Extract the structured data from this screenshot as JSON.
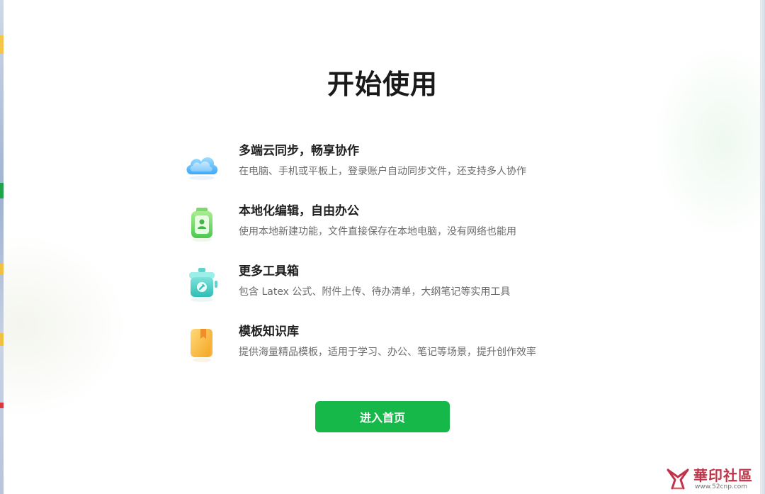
{
  "page": {
    "title": "开始使用"
  },
  "features": [
    {
      "icon": "cloud-sync-icon",
      "title": "多端云同步，畅享协作",
      "description": "在电脑、手机或平板上，登录账户自动同步文件，还支持多人协作"
    },
    {
      "icon": "local-edit-icon",
      "title": "本地化编辑，自由办公",
      "description": "使用本地新建功能，文件直接保存在本地电脑，没有网络也能用"
    },
    {
      "icon": "toolbox-icon",
      "title": "更多工具箱",
      "description": "包含 Latex 公式、附件上传、待办清单，大纲笔记等实用工具"
    },
    {
      "icon": "template-library-icon",
      "title": "模板知识库",
      "description": "提供海量精品模板，适用于学习、办公、笔记等场景，提升创作效率"
    }
  ],
  "actions": {
    "enter_label": "进入首页"
  },
  "watermark": {
    "name": "華印社區",
    "url": "www.52cnp.com"
  },
  "colors": {
    "accent": "#17b84a",
    "title": "#1a1a1a",
    "description": "#6b6b6b",
    "watermark": "#c0344a"
  }
}
